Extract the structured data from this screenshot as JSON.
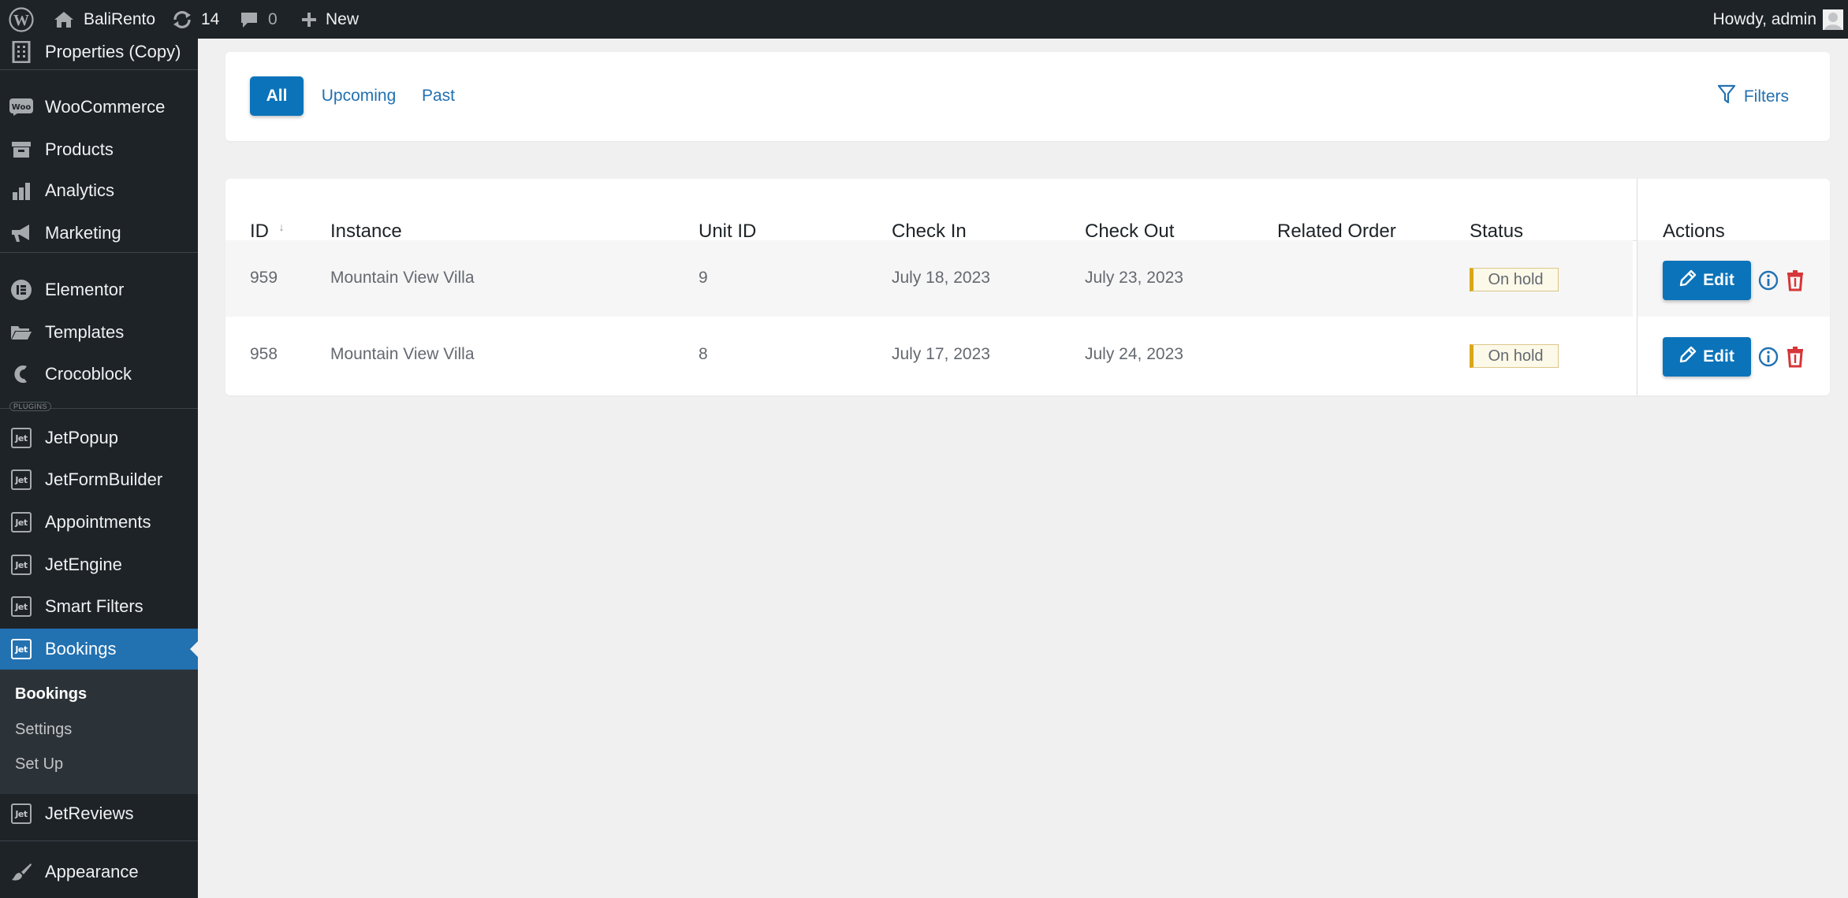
{
  "adminbar": {
    "site_name": "BaliRento",
    "updates_count": "14",
    "comments_count": "0",
    "new_label": "New",
    "greeting": "Howdy, admin"
  },
  "sidebar": {
    "items": [
      {
        "label": "Properties (Copy)",
        "icon": "building-icon"
      },
      {
        "label": "WooCommerce",
        "icon": "woo-icon"
      },
      {
        "label": "Products",
        "icon": "archive-icon"
      },
      {
        "label": "Analytics",
        "icon": "chart-bar-icon"
      },
      {
        "label": "Marketing",
        "icon": "megaphone-icon"
      },
      {
        "label": "Elementor",
        "icon": "elementor-icon"
      },
      {
        "label": "Templates",
        "icon": "folder-icon"
      },
      {
        "label": "Crocoblock",
        "icon": "crocoblock-icon"
      },
      {
        "label": "JetPopup",
        "icon": "jet-icon"
      },
      {
        "label": "JetFormBuilder",
        "icon": "jet-icon"
      },
      {
        "label": "Appointments",
        "icon": "jet-icon"
      },
      {
        "label": "JetEngine",
        "icon": "jet-icon"
      },
      {
        "label": "Smart Filters",
        "icon": "jet-icon"
      },
      {
        "label": "Bookings",
        "icon": "jet-icon"
      },
      {
        "label": "JetReviews",
        "icon": "jet-icon"
      },
      {
        "label": "Appearance",
        "icon": "paintbrush-icon"
      }
    ],
    "plugins_label": "PLUGINS",
    "jet_icon_text": "Jet",
    "submenu": [
      "Bookings",
      "Settings",
      "Set Up"
    ]
  },
  "tabs": [
    "All",
    "Upcoming",
    "Past"
  ],
  "filters_label": "Filters",
  "table": {
    "columns": [
      "ID",
      "Instance",
      "Unit ID",
      "Check In",
      "Check Out",
      "Related Order",
      "Status",
      "Actions"
    ],
    "sort_indicator": "↓",
    "rows": [
      {
        "id": "959",
        "instance": "Mountain View Villa",
        "unit_id": "9",
        "check_in": "July 18, 2023",
        "check_out": "July 23, 2023",
        "related_order": "",
        "status": "On hold"
      },
      {
        "id": "958",
        "instance": "Mountain View Villa",
        "unit_id": "8",
        "check_in": "July 17, 2023",
        "check_out": "July 24, 2023",
        "related_order": "",
        "status": "On hold"
      }
    ],
    "edit_label": "Edit"
  },
  "colors": {
    "admin_dark": "#1d2327",
    "accent_blue": "#2271b1",
    "button_blue": "#0b73ba",
    "delete_red": "#d63638",
    "status_on_hold": "#dba617"
  }
}
